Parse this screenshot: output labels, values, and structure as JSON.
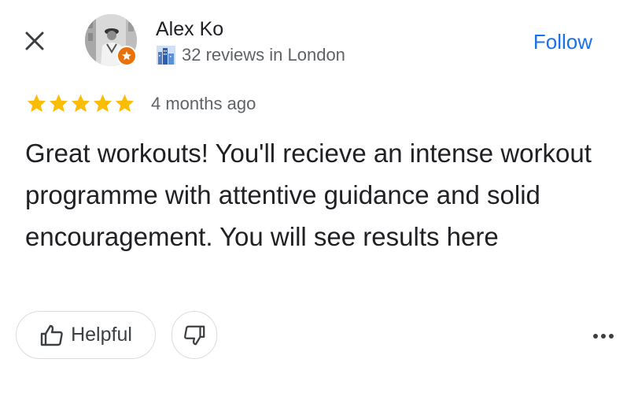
{
  "reviewer": {
    "name": "Alex Ko",
    "meta": "32 reviews in London"
  },
  "follow_label": "Follow",
  "review": {
    "rating": 5,
    "max_rating": 5,
    "time": "4 months ago",
    "text": "Great workouts! You'll recieve an intense workout programme with attentive guidance and solid encouragement. You will see results here"
  },
  "actions": {
    "helpful_label": "Helpful"
  },
  "icons": {
    "close": "close-icon",
    "badge": "local-guide-badge-icon",
    "city": "city-icon",
    "star": "star-icon",
    "thumbs_up": "thumbs-up-icon",
    "thumbs_down": "thumbs-down-icon",
    "more": "more-horizontal-icon"
  },
  "colors": {
    "accent": "#1a73e8",
    "star": "#fbbc04",
    "badge": "#e8710a",
    "secondary_text": "#5f6368"
  }
}
